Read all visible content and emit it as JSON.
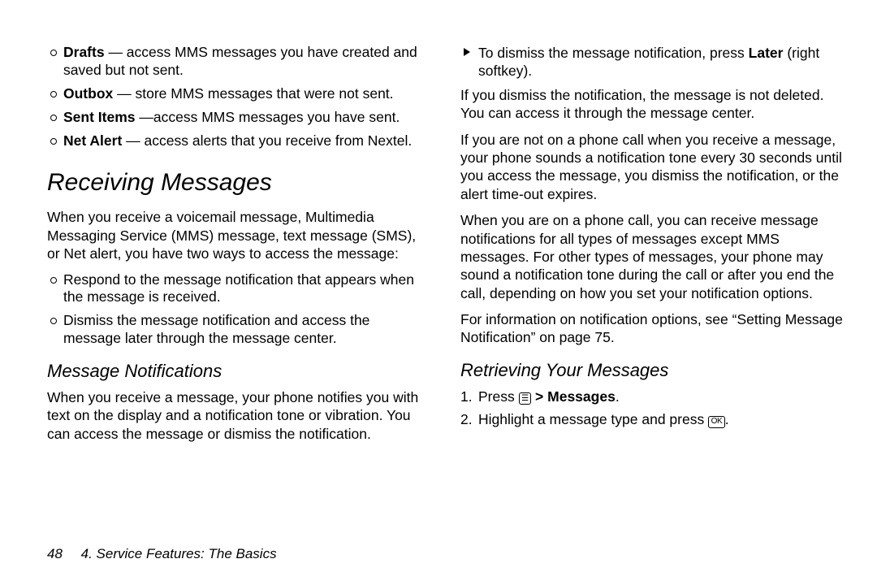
{
  "col1": {
    "defs": [
      {
        "term": "Drafts",
        "desc": " — access MMS messages you have created and saved but not sent."
      },
      {
        "term": "Outbox",
        "desc": " — store MMS messages that were not sent."
      },
      {
        "term": "Sent Items",
        "desc": " —access MMS messages you have sent."
      },
      {
        "term": "Net Alert",
        "desc": " — access alerts that you receive from Nextel."
      }
    ],
    "h1": "Receiving Messages",
    "intro": "When you receive a voicemail message, Multimedia Messaging Service (MMS) message, text message (SMS), or Net alert, you have two ways to access the message:",
    "ways": [
      "Respond to the message notification that appears when the message is received.",
      "Dismiss the message notification and access the message later through the message center."
    ],
    "h2": "Message Notifications",
    "notif_p": "When you receive a message, your phone notifies you with text on the display and a notification tone or vibration. You can access the message or dismiss the notification."
  },
  "col2": {
    "dismiss_pre": "To dismiss the message notification, press ",
    "dismiss_bold": "Later",
    "dismiss_post": " (right softkey).",
    "p2": "If you dismiss the notification, the message is not deleted. You can access it through the message center.",
    "p3": "If you are not on a phone call when you receive a message, your phone sounds a notification tone every 30 seconds until you access the message, you dismiss the notification, or the alert time-out expires.",
    "p4": "When you are on a phone call, you can receive message notifications for all types of messages except MMS messages. For other types of messages, your phone may sound a notification tone during the call or after you end the call, depending on how you set your notification options.",
    "p5": "For information on notification options, see “Setting Message Notification” on page 75.",
    "h2b": "Retrieving Your Messages",
    "step1_a": "Press ",
    "step1_icon": "☰",
    "step1_gt": " > ",
    "step1_b": "Messages",
    "step1_c": ".",
    "step2_a": "Highlight a message type and press ",
    "step2_icon": "OK",
    "step2_b": "."
  },
  "footer": {
    "page": "48",
    "chapter": "4. Service Features: The Basics"
  }
}
